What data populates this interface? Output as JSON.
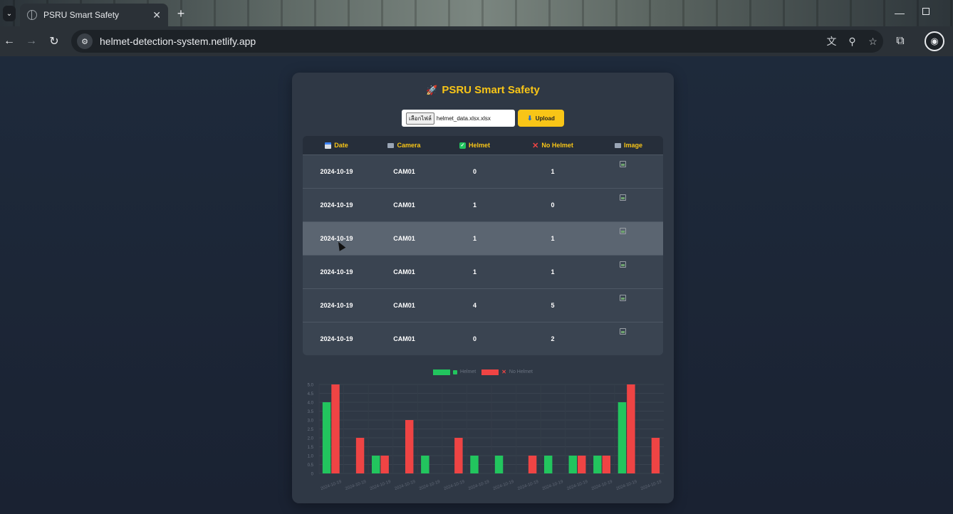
{
  "browser": {
    "tab_title": "PSRU Smart Safety",
    "tab_close": "✕",
    "new_tab": "+",
    "url": "helmet-detection-system.netlify.app"
  },
  "app": {
    "title": "PSRU Smart Safety",
    "rocket_icon": "🚀",
    "file_button": "เลือกไฟล์",
    "file_name": "helmet_data.xlsx.xlsx",
    "upload_label": "Upload",
    "upload_icon": "⬇"
  },
  "table": {
    "headers": {
      "date": "Date",
      "camera": "Camera",
      "helmet": "Helmet",
      "no_helmet": "No Helmet",
      "image": "Image"
    },
    "rows": [
      {
        "date": "2024-10-19",
        "camera": "CAM01",
        "helmet": "0",
        "no_helmet": "1"
      },
      {
        "date": "2024-10-19",
        "camera": "CAM01",
        "helmet": "1",
        "no_helmet": "0"
      },
      {
        "date": "2024-10-19",
        "camera": "CAM01",
        "helmet": "1",
        "no_helmet": "1"
      },
      {
        "date": "2024-10-19",
        "camera": "CAM01",
        "helmet": "1",
        "no_helmet": "1"
      },
      {
        "date": "2024-10-19",
        "camera": "CAM01",
        "helmet": "4",
        "no_helmet": "5"
      },
      {
        "date": "2024-10-19",
        "camera": "CAM01",
        "helmet": "0",
        "no_helmet": "2"
      }
    ]
  },
  "chart_data": {
    "type": "bar",
    "categories": [
      "2024-10-19",
      "2024-10-19",
      "2024-10-19",
      "2024-10-19",
      "2024-10-19",
      "2024-10-19",
      "2024-10-19",
      "2024-10-19",
      "2024-10-19",
      "2024-10-19",
      "2024-10-19",
      "2024-10-19",
      "2024-10-19",
      "2024-10-19"
    ],
    "series": [
      {
        "name": "Helmet",
        "color": "#22c55e",
        "values": [
          4,
          0,
          1,
          0,
          1,
          0,
          1,
          1,
          0,
          1,
          1,
          1,
          4,
          0
        ]
      },
      {
        "name": "No Helmet",
        "color": "#ef4444",
        "values": [
          5,
          2,
          1,
          3,
          0,
          2,
          0,
          0,
          1,
          0,
          1,
          1,
          5,
          2
        ]
      }
    ],
    "yticks": [
      "0",
      "0.5",
      "1.0",
      "1.5",
      "2.0",
      "2.5",
      "3.0",
      "3.5",
      "4.0",
      "4.5",
      "5.0"
    ],
    "ylim": [
      0,
      5
    ],
    "grid": true,
    "legend": "top"
  },
  "colors": {
    "accent": "#f8c517",
    "helmet": "#22c55e",
    "no_helmet": "#ef4444"
  }
}
